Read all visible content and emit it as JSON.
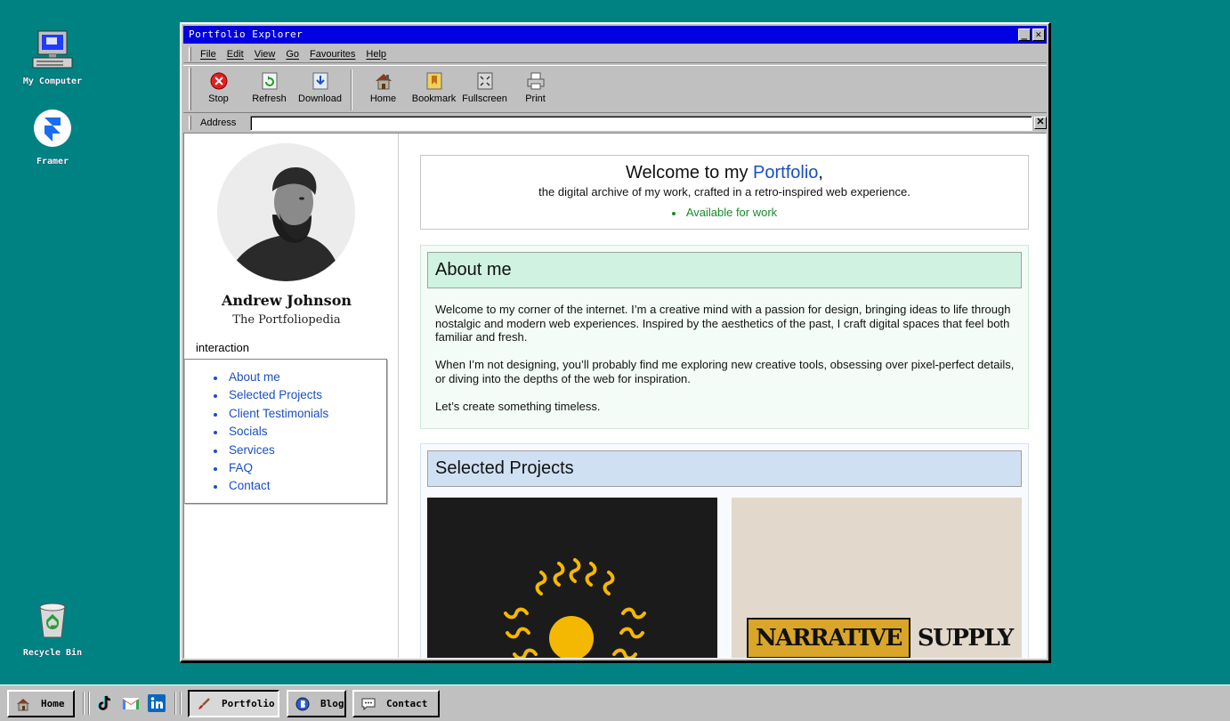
{
  "desktop": {
    "icons": [
      {
        "label": "My Computer"
      },
      {
        "label": "Framer"
      },
      {
        "label": "Recycle Bin"
      }
    ]
  },
  "window": {
    "title": "Portfolio Explorer",
    "minimize": "_",
    "close": "✕",
    "menu": [
      "File",
      "Edit",
      "View",
      "Go",
      "Favourites",
      "Help"
    ],
    "toolbar": [
      "Stop",
      "Refresh",
      "Download",
      "Home",
      "Bookmark",
      "Fullscreen",
      "Print"
    ],
    "address_label": "Address",
    "address_value": "",
    "address_close": "✕"
  },
  "profile": {
    "name": "Andrew Johnson",
    "tagline": "The Portfoliopedia",
    "nav_heading": "interaction",
    "nav": [
      "About me",
      "Selected Projects",
      "Client Testimonials",
      "Socials",
      "Services",
      "FAQ",
      "Contact"
    ]
  },
  "welcome": {
    "title_pre": "Welcome to my ",
    "title_highlight": "Portfolio",
    "title_post": ",",
    "subtitle": "the digital archive of my work, crafted in a retro-inspired web experience.",
    "status": "Available for work"
  },
  "about": {
    "heading": "About me",
    "paragraphs": [
      "Welcome to my corner of the internet. I’m a creative mind with a passion for design, bringing ideas to life through nostalgic and modern web experiences. Inspired by the aesthetics of the past, I craft digital spaces that feel both familiar and fresh.",
      "When I’m not designing, you’ll probably find me exploring new creative tools, obsessing over pixel-perfect details, or diving into the depths of the web for inspiration.",
      "Let’s create something timeless."
    ]
  },
  "projects": {
    "heading": "Selected Projects",
    "items": [
      {
        "logo_text": "",
        "accent": "#f5b800"
      },
      {
        "logo_box": "NARRATIVE",
        "logo_plain": "SUPPLY",
        "accent": "#d9a62a"
      }
    ]
  },
  "taskbar": {
    "buttons": [
      "Home",
      "Portfolio",
      "Blog",
      "Contact"
    ],
    "active": "Portfolio",
    "socials": [
      "tiktok-icon",
      "gmail-icon",
      "linkedin-icon"
    ]
  },
  "colors": {
    "desktop": "#008282",
    "titlebar": "#0000e0",
    "link": "#1a4fc4",
    "available": "#1a8a2a",
    "about_bg": "#cff3e0",
    "projects_bg": "#cfe0f3"
  }
}
